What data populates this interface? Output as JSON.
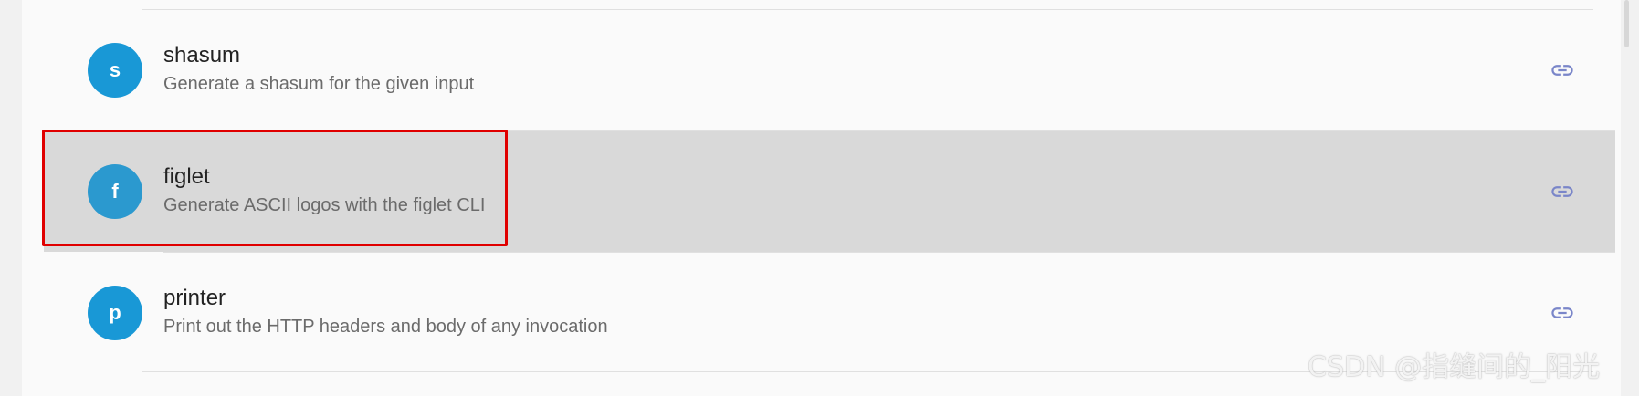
{
  "functions": [
    {
      "avatar_letter": "s",
      "name": "shasum",
      "description": "Generate a shasum for the given input",
      "icon": "link-icon"
    },
    {
      "avatar_letter": "f",
      "name": "figlet",
      "description": "Generate ASCII logos with the figlet CLI",
      "icon": "link-icon",
      "hovered": true,
      "highlighted": true
    },
    {
      "avatar_letter": "p",
      "name": "printer",
      "description": "Print out the HTTP headers and body of any invocation",
      "icon": "link-icon"
    }
  ],
  "colors": {
    "avatar": "#1998d6",
    "link_icon": "#7a86c9",
    "highlight_border": "#e00000",
    "hover_row": "#d9d9d9"
  },
  "watermark": "CSDN @指缝间的_阳光"
}
